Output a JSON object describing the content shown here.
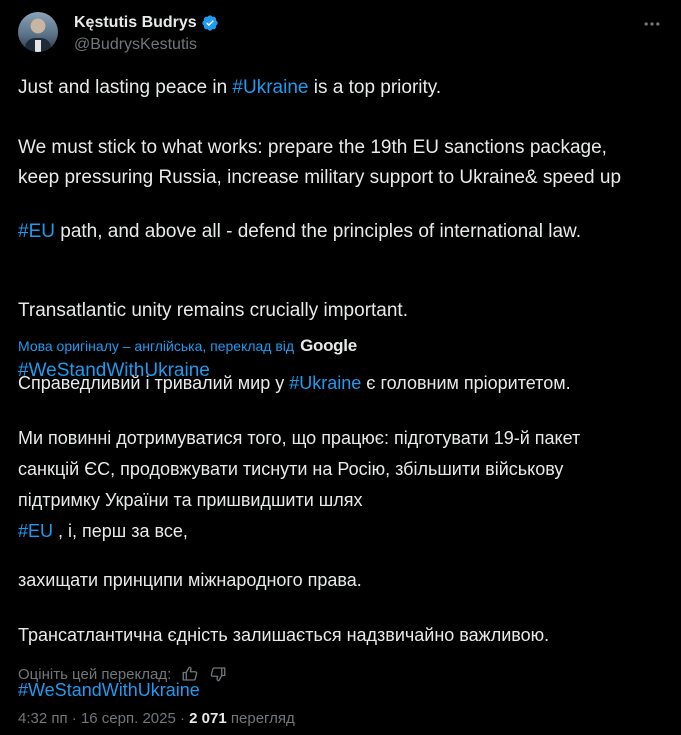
{
  "author": {
    "name": "Kęstutis Budrys",
    "handle": "@BudrysKestutis",
    "verified": true
  },
  "icons": {
    "verified": "verified-badge-icon",
    "more": "more-horizontal-icon",
    "thumb_up": "thumbs-up-icon",
    "thumb_down": "thumbs-down-icon"
  },
  "tweet": {
    "p1_pre": "Just and lasting peace in ",
    "p1_tag": "#Ukraine",
    "p1_post": " is a top priority.",
    "p2_l1": "We must stick to what works: prepare the 19th EU sanctions package,",
    "p2_l2": "keep pressuring Russia, increase military support to Ukraine& speed up",
    "p2_l3_tag": "#EU",
    "p2_l3_post": " path, and above all - defend the principles of international law.",
    "p3": "Transatlantic unity remains crucially important.",
    "p4_tag": "#WeStandWithUkraine"
  },
  "translation_note": {
    "text": "Мова оригіналу – англійська, переклад від",
    "provider": "Google"
  },
  "translation": {
    "p1_pre": "Справедливий і тривалий мир у ",
    "p1_tag": "#Ukraine",
    "p1_post": " є головним пріоритетом.",
    "p2_l1": "Ми повинні дотримуватися того, що працює: підготувати 19-й пакет",
    "p2_l2": "санкцій ЄС, продовжувати тиснути на Росію, збільшити військову",
    "p2_l3_pre": "підтримку України та пришвидшити шлях ",
    "p2_l3_tag": "#EU",
    "p2_l3_post": " , і, перш за все,",
    "p2_l4": "захищати принципи міжнародного права.",
    "p3": "Трансатлантична єдність залишається надзвичайно важливою.",
    "p4_tag": "#WeStandWithUkraine"
  },
  "rate": {
    "label": "Оцініть цей переклад:"
  },
  "meta": {
    "time": "4:32 пп",
    "sep": " · ",
    "date": "16 серп. 2025",
    "views_count": "2 071",
    "views_label": "перегляд"
  },
  "colors": {
    "background": "#000000",
    "text": "#e7e9ea",
    "muted": "#71767b",
    "link": "#1d9bf0",
    "verified": "#1d9bf0"
  }
}
